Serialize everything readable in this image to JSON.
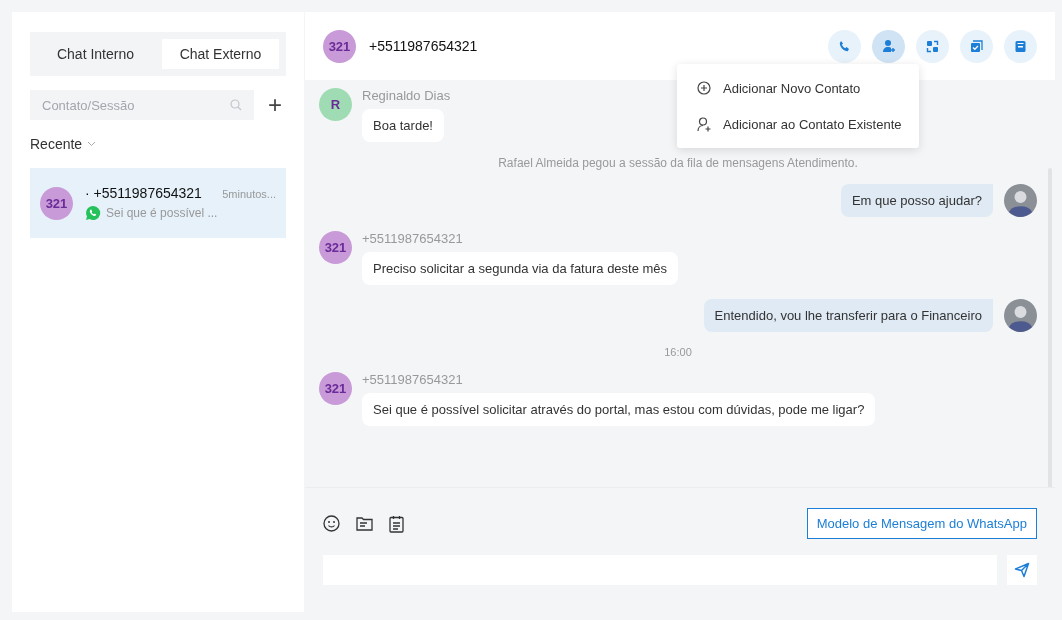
{
  "tabs": [
    {
      "label": "Chat Interno",
      "selected": false
    },
    {
      "label": "Chat Externo",
      "selected": true
    }
  ],
  "search": {
    "placeholder": "Contato/Sessão"
  },
  "add_button": "+",
  "filter": {
    "label": "Recente"
  },
  "sessions": [
    {
      "avatar": "321",
      "name": "· +5511987654321",
      "time": "5minutos...",
      "preview": "Sei que é possível ...",
      "selected": true
    }
  ],
  "header": {
    "avatar": "321",
    "name": "+5511987654321",
    "actions": [
      {
        "selected": false
      },
      {
        "selected": true
      },
      {
        "selected": false
      },
      {
        "selected": false
      },
      {
        "selected": false
      }
    ]
  },
  "menu": {
    "items": [
      {
        "label": "Adicionar Novo Contato"
      },
      {
        "label": "Adicionar ao Contato Existente"
      }
    ]
  },
  "messages": [
    {
      "kind": "incoming",
      "avatar": "R",
      "color": "#9fdcb4",
      "sender": "Reginaldo Dias",
      "text": "Boa tarde!"
    },
    {
      "kind": "system",
      "text": "Rafael Almeida pegou a sessão da fila de mensagens Atendimento."
    },
    {
      "kind": "outgoing",
      "text": "Em que posso ajudar?"
    },
    {
      "kind": "incoming",
      "avatar": "321",
      "color": "#c89ad8",
      "sender": "+5511987654321",
      "text": "Preciso solicitar a segunda via da fatura deste mês"
    },
    {
      "kind": "outgoing",
      "text": "Entendido, vou lhe transferir para o Financeiro"
    },
    {
      "kind": "time",
      "text": "16:00"
    },
    {
      "kind": "incoming",
      "avatar": "321",
      "color": "#c89ad8",
      "sender": "+5511987654321",
      "text": "Sei que é possível solicitar através do portal, mas estou com dúvidas, pode me ligar?"
    }
  ],
  "composer": {
    "template_button": "Modelo de Mensagem do WhatsApp"
  }
}
